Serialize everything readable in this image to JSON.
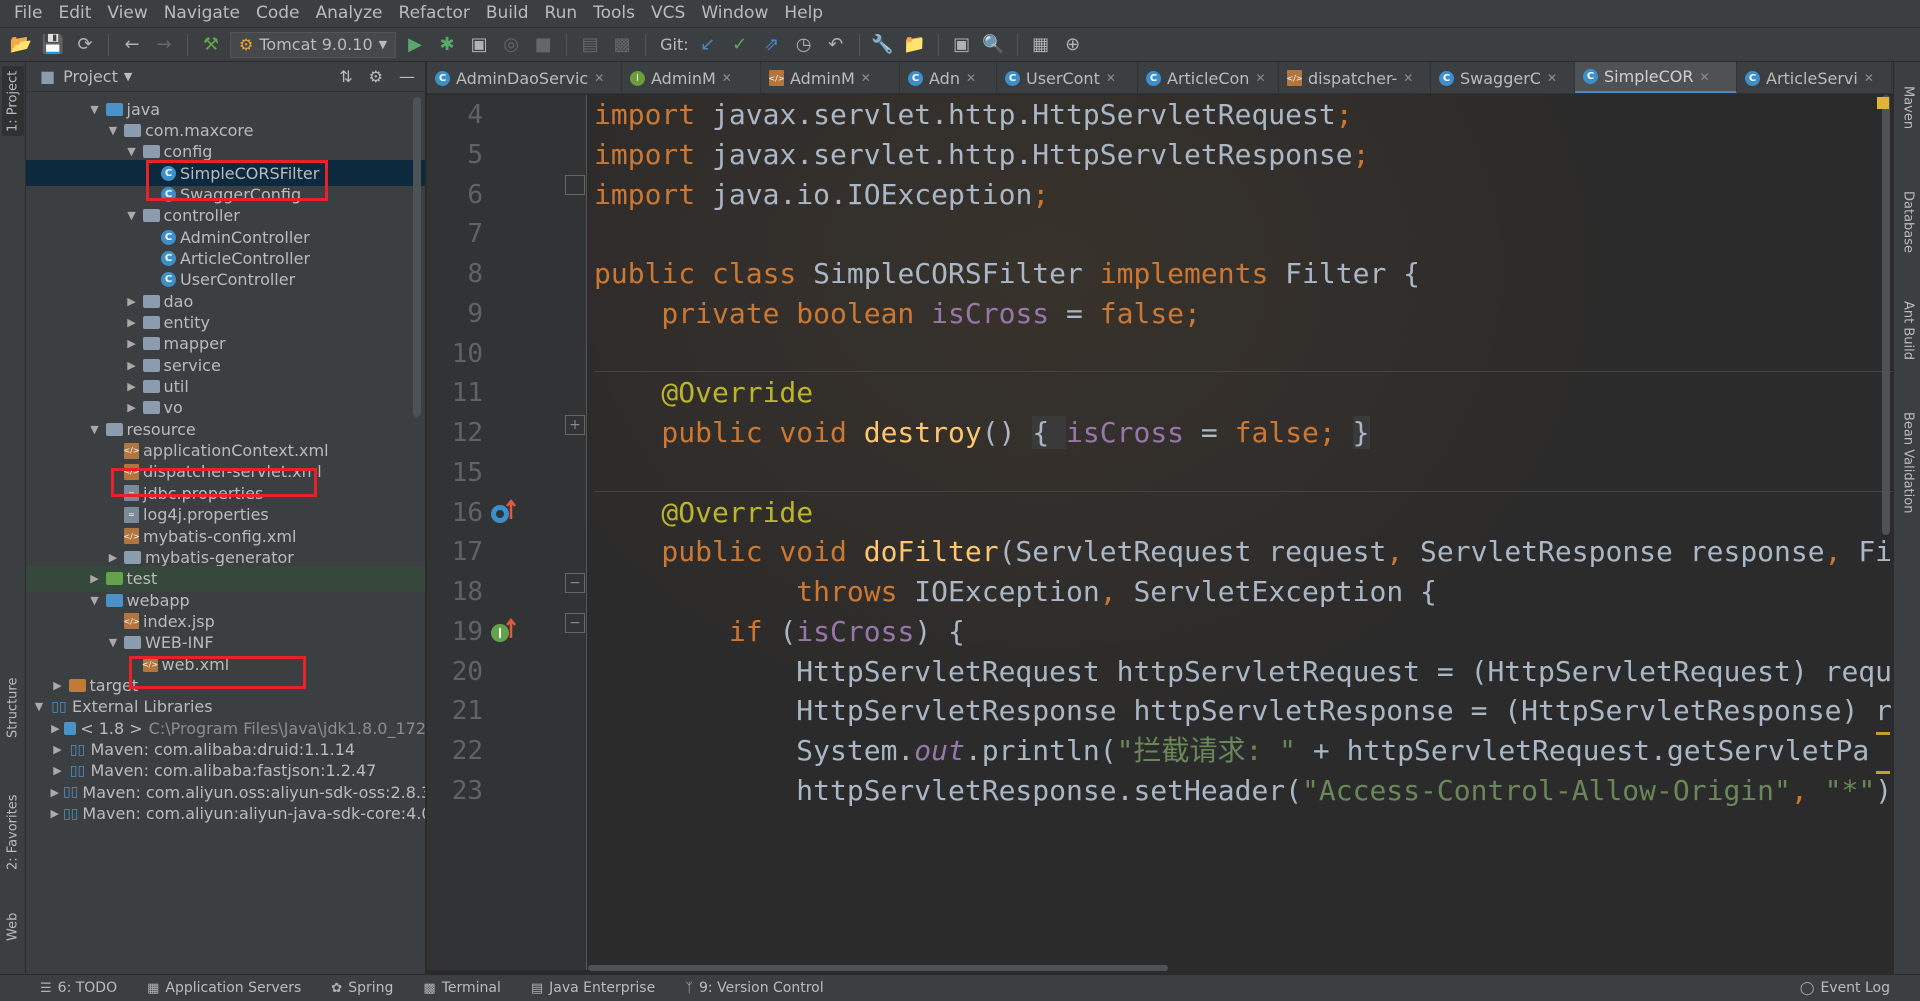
{
  "menu": [
    "File",
    "Edit",
    "View",
    "Navigate",
    "Code",
    "Analyze",
    "Refactor",
    "Build",
    "Run",
    "Tools",
    "VCS",
    "Window",
    "Help"
  ],
  "toolbar": {
    "run_config": "Tomcat 9.0.10",
    "git_label": "Git:"
  },
  "left_stripe": {
    "project": "1: Project",
    "structure": "Structure",
    "favorites": "2: Favorites",
    "web": "Web"
  },
  "project_panel": {
    "title": "Project"
  },
  "tree": [
    {
      "label": "java",
      "indent": 3,
      "arrow": "down",
      "icon": "folder-blue"
    },
    {
      "label": "com.maxcore",
      "indent": 4,
      "arrow": "down",
      "icon": "folder"
    },
    {
      "label": "config",
      "indent": 5,
      "arrow": "down",
      "icon": "folder"
    },
    {
      "label": "SimpleCORSFilter",
      "indent": 6,
      "arrow": "",
      "icon": "class",
      "selected": true
    },
    {
      "label": "SwaggerConfig",
      "indent": 6,
      "arrow": "",
      "icon": "class"
    },
    {
      "label": "controller",
      "indent": 5,
      "arrow": "down",
      "icon": "folder"
    },
    {
      "label": "AdminController",
      "indent": 6,
      "arrow": "",
      "icon": "class"
    },
    {
      "label": "ArticleController",
      "indent": 6,
      "arrow": "",
      "icon": "class"
    },
    {
      "label": "UserController",
      "indent": 6,
      "arrow": "",
      "icon": "class"
    },
    {
      "label": "dao",
      "indent": 5,
      "arrow": "right",
      "icon": "folder"
    },
    {
      "label": "entity",
      "indent": 5,
      "arrow": "right",
      "icon": "folder"
    },
    {
      "label": "mapper",
      "indent": 5,
      "arrow": "right",
      "icon": "folder"
    },
    {
      "label": "service",
      "indent": 5,
      "arrow": "right",
      "icon": "folder"
    },
    {
      "label": "util",
      "indent": 5,
      "arrow": "right",
      "icon": "folder"
    },
    {
      "label": "vo",
      "indent": 5,
      "arrow": "right",
      "icon": "folder"
    },
    {
      "label": "resource",
      "indent": 3,
      "arrow": "down",
      "icon": "folder-res"
    },
    {
      "label": "applicationContext.xml",
      "indent": 4,
      "arrow": "",
      "icon": "xml"
    },
    {
      "label": "dispatcher-servlet.xml",
      "indent": 4,
      "arrow": "",
      "icon": "xml"
    },
    {
      "label": "jdbc.properties",
      "indent": 4,
      "arrow": "",
      "icon": "prop"
    },
    {
      "label": "log4j.properties",
      "indent": 4,
      "arrow": "",
      "icon": "prop"
    },
    {
      "label": "mybatis-config.xml",
      "indent": 4,
      "arrow": "",
      "icon": "xml"
    },
    {
      "label": "mybatis-generator",
      "indent": 4,
      "arrow": "right",
      "icon": "folder"
    },
    {
      "label": "test",
      "indent": 3,
      "arrow": "right",
      "icon": "folder-green",
      "test": true
    },
    {
      "label": "webapp",
      "indent": 3,
      "arrow": "down",
      "icon": "folder-blue"
    },
    {
      "label": "index.jsp",
      "indent": 4,
      "arrow": "",
      "icon": "xml"
    },
    {
      "label": "WEB-INF",
      "indent": 4,
      "arrow": "down",
      "icon": "folder"
    },
    {
      "label": "web.xml",
      "indent": 5,
      "arrow": "",
      "icon": "xml"
    },
    {
      "label": "target",
      "indent": 1,
      "arrow": "right",
      "icon": "folder-orange"
    },
    {
      "label": "External Libraries",
      "indent": 0,
      "arrow": "down",
      "icon": "lib"
    },
    {
      "label": "< 1.8 >",
      "sub": "C:\\Program Files\\Java\\jdk1.8.0_172",
      "indent": 1,
      "arrow": "right",
      "icon": "folder-blue"
    },
    {
      "label": "Maven: com.alibaba:druid:1.1.14",
      "indent": 1,
      "arrow": "right",
      "icon": "lib"
    },
    {
      "label": "Maven: com.alibaba:fastjson:1.2.47",
      "indent": 1,
      "arrow": "right",
      "icon": "lib"
    },
    {
      "label": "Maven: com.aliyun.oss:aliyun-sdk-oss:2.8.3",
      "indent": 1,
      "arrow": "right",
      "icon": "lib"
    },
    {
      "label": "Maven: com.aliyun:aliyun-java-sdk-core:4.0",
      "indent": 1,
      "arrow": "right",
      "icon": "lib"
    }
  ],
  "tabs": [
    {
      "label": "AdminDaoServic",
      "icon": "class",
      "active": false
    },
    {
      "label": "AdminM",
      "icon": "interface",
      "active": false
    },
    {
      "label": "AdminM",
      "icon": "xml",
      "active": false
    },
    {
      "label": "Adn",
      "icon": "class",
      "active": false
    },
    {
      "label": "UserCont",
      "icon": "class",
      "active": false
    },
    {
      "label": "ArticleCon",
      "icon": "class",
      "active": false
    },
    {
      "label": "dispatcher-",
      "icon": "xml",
      "active": false
    },
    {
      "label": "SwaggerC",
      "icon": "class",
      "active": false
    },
    {
      "label": "SimpleCOR",
      "icon": "class",
      "active": true
    },
    {
      "label": "ArticleServi",
      "icon": "class",
      "active": false
    }
  ],
  "line_numbers": [
    "4",
    "5",
    "6",
    "7",
    "8",
    "9",
    "10",
    "11",
    "12",
    "15",
    "16",
    "17",
    "18",
    "19",
    "20",
    "21",
    "22",
    "23"
  ],
  "code_lines": [
    [
      {
        "t": "import ",
        "c": "kw"
      },
      {
        "t": "javax.servlet.http.HttpServletRequest",
        "c": ""
      },
      {
        "t": ";",
        "c": "kw"
      }
    ],
    [
      {
        "t": "import ",
        "c": "kw"
      },
      {
        "t": "javax.servlet.http.HttpServletResponse",
        "c": ""
      },
      {
        "t": ";",
        "c": "kw"
      }
    ],
    [
      {
        "t": "import ",
        "c": "kw"
      },
      {
        "t": "java.io.IOException",
        "c": ""
      },
      {
        "t": ";",
        "c": "kw"
      }
    ],
    [],
    [
      {
        "t": "public class ",
        "c": "kw"
      },
      {
        "t": "SimpleCORSFilter ",
        "c": ""
      },
      {
        "t": "implements ",
        "c": "kw"
      },
      {
        "t": "Filter {",
        "c": ""
      }
    ],
    [
      {
        "t": "    private boolean ",
        "c": "kw"
      },
      {
        "t": "isCross",
        "c": "fld"
      },
      {
        "t": " = ",
        "c": ""
      },
      {
        "t": "false",
        "c": "kw"
      },
      {
        "t": ";",
        "c": "kw"
      }
    ],
    [],
    [
      {
        "t": "    @Override",
        "c": "ann"
      }
    ],
    [
      {
        "t": "    public void ",
        "c": "kw"
      },
      {
        "t": "destroy",
        "c": "fn"
      },
      {
        "t": "() ",
        "c": ""
      },
      {
        "t": "{ ",
        "c": "dim"
      },
      {
        "t": "isCross",
        "c": "fld"
      },
      {
        "t": " = ",
        "c": ""
      },
      {
        "t": "false",
        "c": "kw"
      },
      {
        "t": "; ",
        "c": "kw"
      },
      {
        "t": "}",
        "c": "dim"
      }
    ],
    [],
    [
      {
        "t": "    @Override",
        "c": "ann"
      }
    ],
    [
      {
        "t": "    public void ",
        "c": "kw"
      },
      {
        "t": "doFilter",
        "c": "fn"
      },
      {
        "t": "(ServletRequest request",
        "c": ""
      },
      {
        "t": ", ",
        "c": "kw"
      },
      {
        "t": "ServletResponse response",
        "c": ""
      },
      {
        "t": ", ",
        "c": "kw"
      },
      {
        "t": "Fi",
        "c": ""
      }
    ],
    [
      {
        "t": "            throws ",
        "c": "kw"
      },
      {
        "t": "IOException",
        "c": ""
      },
      {
        "t": ", ",
        "c": "kw"
      },
      {
        "t": "ServletException {",
        "c": ""
      }
    ],
    [
      {
        "t": "        if ",
        "c": "kw"
      },
      {
        "t": "(",
        "c": ""
      },
      {
        "t": "isCross",
        "c": "fld"
      },
      {
        "t": ") {",
        "c": ""
      }
    ],
    [
      {
        "t": "            HttpServletRequest httpServletRequest = (HttpServletRequest) requ",
        "c": ""
      }
    ],
    [
      {
        "t": "            HttpServletResponse httpServletResponse = (HttpServletResponse) r",
        "c": ""
      }
    ],
    [
      {
        "t": "            System.",
        "c": ""
      },
      {
        "t": "out",
        "c": "st"
      },
      {
        "t": ".println(",
        "c": ""
      },
      {
        "t": "\"拦截请求: \"",
        "c": "str"
      },
      {
        "t": " + httpServletRequest.getServletPa",
        "c": ""
      }
    ],
    [
      {
        "t": "            httpServletResponse.setHeader(",
        "c": ""
      },
      {
        "t": "\"Access-Control-Allow-Origin\"",
        "c": "str"
      },
      {
        "t": ", ",
        "c": "kw"
      },
      {
        "t": "\"*\"",
        "c": "str"
      },
      {
        "t": ")",
        "c": ""
      }
    ]
  ],
  "right_stripe": {
    "maven": "Maven",
    "database": "Database",
    "ant": "Ant Build",
    "bean": "Bean Validation"
  },
  "bottom_bar": {
    "todo": "6: TODO",
    "app_servers": "Application Servers",
    "spring": "Spring",
    "terminal": "Terminal",
    "java_ee": "Java Enterprise",
    "vcs": "9: Version Control",
    "event_log": "Event Log"
  },
  "colors": {
    "highlight_box": "#e8212b",
    "keyword": "#cc7832",
    "annotation": "#bbb529",
    "function": "#ffc66d",
    "field": "#9876aa",
    "string": "#6a8759"
  }
}
